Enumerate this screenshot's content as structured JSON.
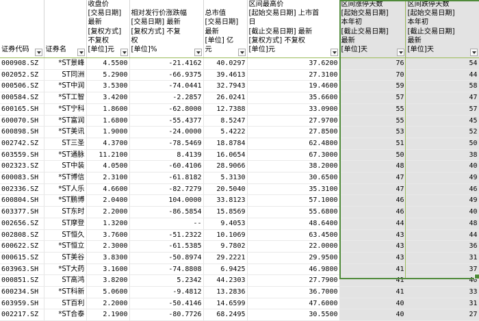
{
  "columns": [
    {
      "key": "code",
      "lines": [
        "",
        "",
        "",
        "",
        "",
        "证券代码"
      ],
      "filter": true
    },
    {
      "key": "name",
      "lines": [
        "",
        "",
        "",
        "",
        "",
        "证券名"
      ],
      "filter": true
    },
    {
      "key": "close",
      "lines": [
        "收盘价",
        "[交易日期]",
        "最新",
        "[复权方式]",
        "不复权",
        "[单位]元"
      ],
      "filter": true
    },
    {
      "key": "rise",
      "lines": [
        "",
        "相对发行价涨跌幅",
        "[交易日期]    最新",
        "[复权方式]    不复",
        "权",
        "[单位]%"
      ],
      "filter": true
    },
    {
      "key": "mcap",
      "lines": [
        "",
        "总市值",
        "[交易日期]",
        "最新",
        "[单位]    亿",
        "元"
      ],
      "filter": true
    },
    {
      "key": "high",
      "lines": [
        "区间最高价",
        "[起始交易日期]    上市首",
        "日",
        "[截止交易日期]    最新",
        "[复权方式]    不复权",
        "[单位]元"
      ],
      "filter": true
    },
    {
      "key": "up",
      "lines": [
        "区间涨停天数",
        "[起始交易日期]",
        "本年初",
        "[截止交易日期]",
        "最新",
        "[单位]天"
      ],
      "filter": true
    },
    {
      "key": "down",
      "lines": [
        "区间跌停天数",
        "[起始交易日期]",
        "本年初",
        "[截止交易日期]",
        "最新",
        "[单位]天"
      ],
      "filter": true
    }
  ],
  "rows": [
    {
      "code": "000908.SZ",
      "name": "*ST景峰",
      "close": "4.5500",
      "rise": "-21.4162",
      "mcap": "40.0297",
      "high": "37.6200",
      "up": "76",
      "down": "54"
    },
    {
      "code": "002052.SZ",
      "name": "ST同洲",
      "close": "5.2900",
      "rise": "-66.9375",
      "mcap": "39.4613",
      "high": "27.3100",
      "up": "70",
      "down": "44"
    },
    {
      "code": "000506.SZ",
      "name": "*ST中润",
      "close": "3.5300",
      "rise": "-74.0441",
      "mcap": "32.7943",
      "high": "19.4600",
      "up": "59",
      "down": "58"
    },
    {
      "code": "000584.SZ",
      "name": "*ST工智",
      "close": "3.4200",
      "rise": "-2.2857",
      "mcap": "26.0241",
      "high": "35.6600",
      "up": "57",
      "down": "47"
    },
    {
      "code": "600165.SH",
      "name": "*ST宁科",
      "close": "1.8600",
      "rise": "-62.8000",
      "mcap": "12.7388",
      "high": "33.0900",
      "up": "55",
      "down": "57"
    },
    {
      "code": "600070.SH",
      "name": "*ST富润",
      "close": "1.6800",
      "rise": "-55.4377",
      "mcap": "8.5247",
      "high": "27.9700",
      "up": "55",
      "down": "45"
    },
    {
      "code": "600898.SH",
      "name": "*ST美讯",
      "close": "1.9000",
      "rise": "-24.0000",
      "mcap": "5.4222",
      "high": "27.8500",
      "up": "53",
      "down": "52"
    },
    {
      "code": "002742.SZ",
      "name": "ST三圣",
      "close": "4.3700",
      "rise": "-78.5469",
      "mcap": "18.8784",
      "high": "62.4800",
      "up": "51",
      "down": "50"
    },
    {
      "code": "603559.SH",
      "name": "*ST通脉",
      "close": "11.2100",
      "rise": "8.4139",
      "mcap": "16.0654",
      "high": "67.3000",
      "up": "50",
      "down": "38"
    },
    {
      "code": "002323.SZ",
      "name": "ST中装",
      "close": "4.0500",
      "rise": "-60.4106",
      "mcap": "28.9066",
      "high": "38.2000",
      "up": "48",
      "down": "40"
    },
    {
      "code": "600083.SH",
      "name": "*ST博信",
      "close": "2.3100",
      "rise": "-61.8182",
      "mcap": "5.3130",
      "high": "30.6500",
      "up": "47",
      "down": "49"
    },
    {
      "code": "002336.SZ",
      "name": "*ST人乐",
      "close": "4.6600",
      "rise": "-82.7279",
      "mcap": "20.5040",
      "high": "35.3100",
      "up": "47",
      "down": "46"
    },
    {
      "code": "600804.SH",
      "name": "*ST鹏博",
      "close": "2.0400",
      "rise": "104.0000",
      "mcap": "33.8123",
      "high": "57.1000",
      "up": "46",
      "down": "49"
    },
    {
      "code": "603377.SH",
      "name": "ST东时",
      "close": "2.2000",
      "rise": "-86.5854",
      "mcap": "15.8569",
      "high": "55.6800",
      "up": "46",
      "down": "40"
    },
    {
      "code": "002656.SZ",
      "name": "ST摩登",
      "close": "1.3200",
      "rise": "--",
      "mcap": "9.4053",
      "high": "48.6400",
      "up": "44",
      "down": "48"
    },
    {
      "code": "002808.SZ",
      "name": "ST恒久",
      "close": "3.7600",
      "rise": "-51.2322",
      "mcap": "10.1069",
      "high": "63.4500",
      "up": "43",
      "down": "44"
    },
    {
      "code": "600622.SZ",
      "name": "*ST恒立",
      "close": "2.3000",
      "rise": "-61.5385",
      "mcap": "9.7802",
      "high": "22.0000",
      "up": "43",
      "down": "36"
    },
    {
      "code": "000615.SZ",
      "name": "ST美谷",
      "close": "3.8300",
      "rise": "-50.8974",
      "mcap": "29.2221",
      "high": "29.9500",
      "up": "43",
      "down": "31"
    },
    {
      "code": "603963.SH",
      "name": "*ST大药",
      "close": "3.1600",
      "rise": "-74.8808",
      "mcap": "6.9425",
      "high": "46.9800",
      "up": "41",
      "down": "37"
    },
    {
      "code": "000851.SZ",
      "name": "ST高鸿",
      "close": "3.8200",
      "rise": "5.2342",
      "mcap": "44.2303",
      "high": "27.7900",
      "up": "41",
      "down": "40"
    },
    {
      "code": "600234.SH",
      "name": "*ST科新",
      "close": "5.0600",
      "rise": "-9.4812",
      "mcap": "13.2836",
      "high": "36.7000",
      "up": "41",
      "down": "33"
    },
    {
      "code": "603959.SH",
      "name": "ST百利",
      "close": "2.2000",
      "rise": "-50.4146",
      "mcap": "14.6599",
      "high": "47.6000",
      "up": "40",
      "down": "31"
    },
    {
      "code": "002217.SZ",
      "name": "*ST合泰",
      "close": "2.1900",
      "rise": "-80.7726",
      "mcap": "68.2495",
      "high": "30.5500",
      "up": "40",
      "down": "27"
    }
  ]
}
